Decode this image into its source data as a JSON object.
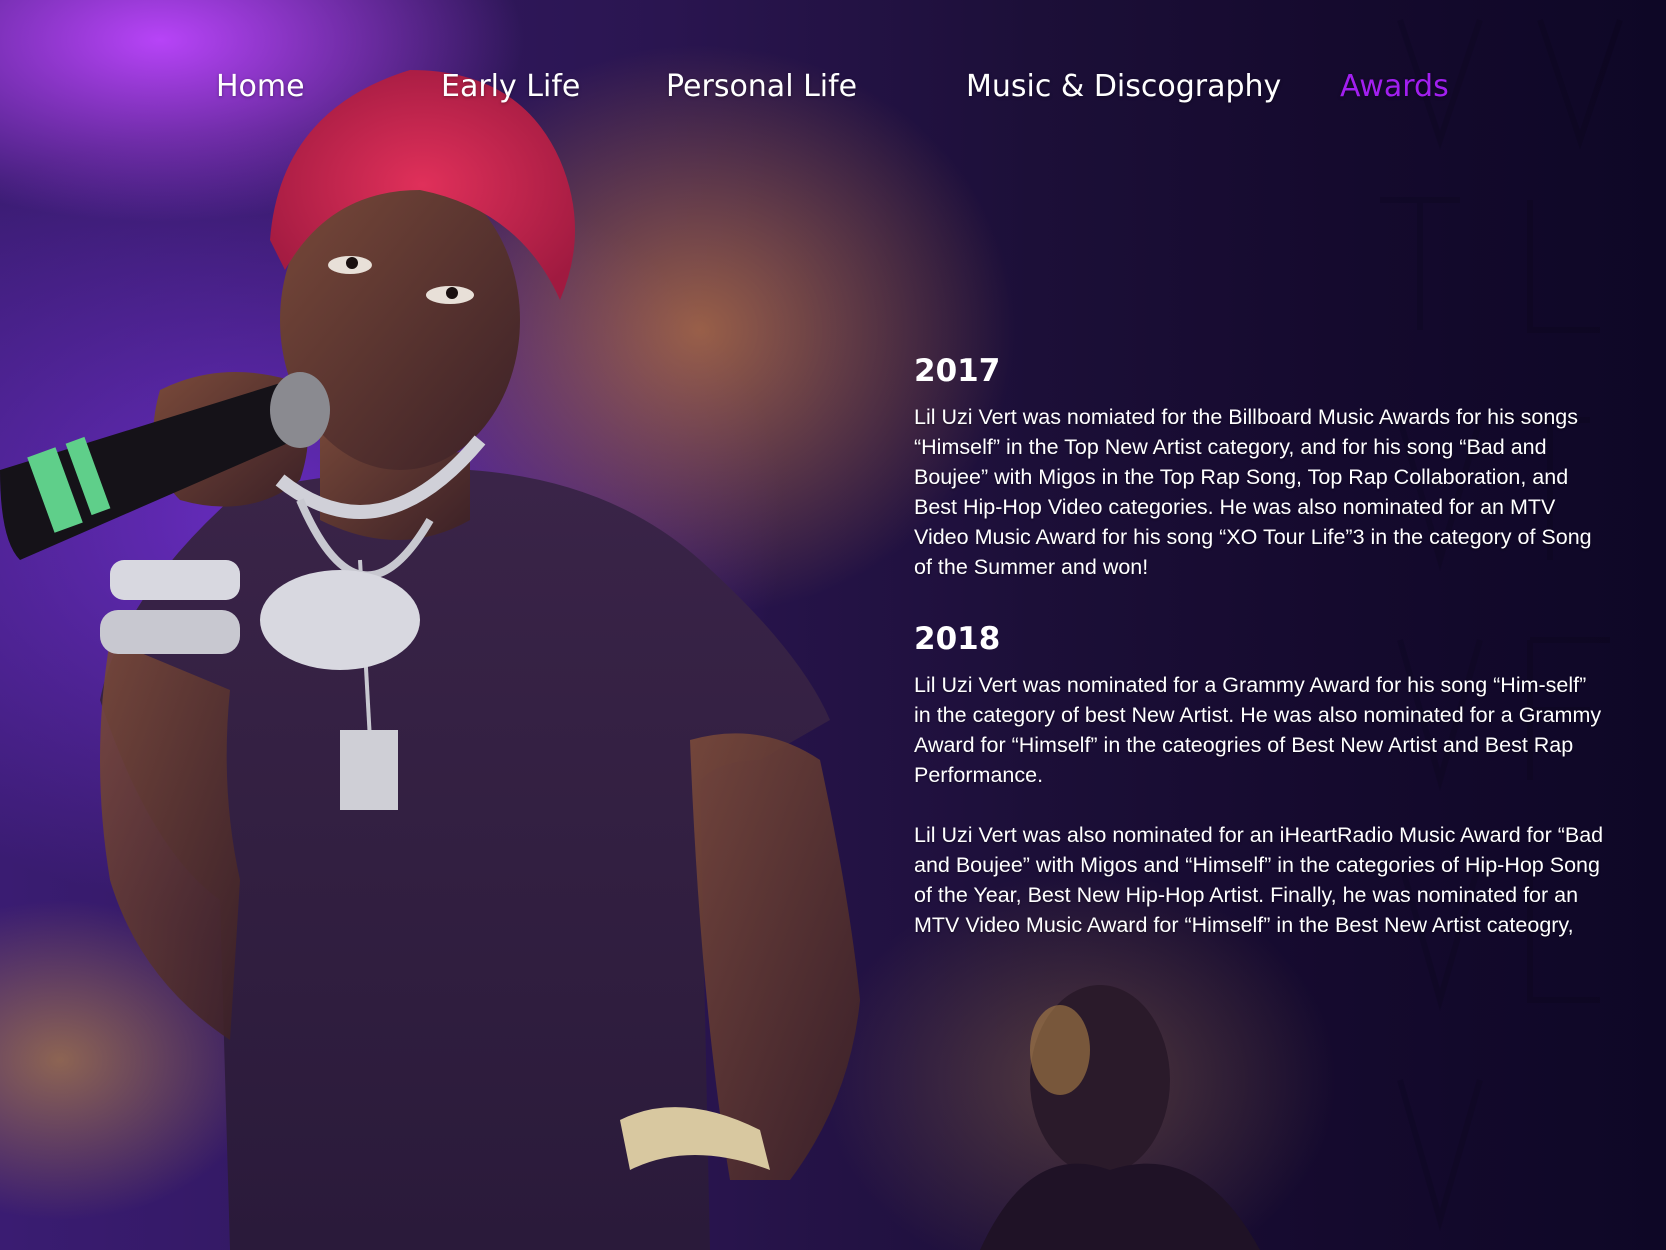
{
  "nav": {
    "items": [
      {
        "label": "Home"
      },
      {
        "label": "Early Life"
      },
      {
        "label": "Personal Life"
      },
      {
        "label": "Music & Discography"
      },
      {
        "label": "Awards"
      }
    ],
    "active": "Awards"
  },
  "awards": [
    {
      "year": "2017",
      "paragraphs": [
        "Lil Uzi Vert was nomiated for the Billboard Music Awards for his songs “Himself” in the Top New Artist category, and for his song “Bad and Boujee” with Migos in the Top Rap Song, Top Rap Collaboration, and Best Hip-Hop Video categories. He was also nominated for an MTV Video Music Award for his song “XO Tour Life”3 in the category of Song of the Summer and won!"
      ]
    },
    {
      "year": "2018",
      "paragraphs": [
        "Lil Uzi Vert was nominated for a Grammy Award for his song “Him-self” in the category of best New Artist. He was also nominated for a Grammy Award for “Himself” in the cateogries of Best New Artist and Best Rap Performance.",
        "Lil Uzi Vert was also nominated for an iHeartRadio Music Award for “Bad and Boujee” with Migos and “Himself” in the categories of Hip-Hop Song of the Year, Best New Hip-Hop Artist. Finally, he was nominated for an MTV Video Music Award for “Himself” in the Best New Artist cateogry,"
      ]
    }
  ],
  "colors": {
    "accent": "#a21ff0",
    "text": "#ffffff",
    "background": "#14092a"
  },
  "images": {
    "hero": "performer-photo",
    "background": "crowd-photo"
  }
}
